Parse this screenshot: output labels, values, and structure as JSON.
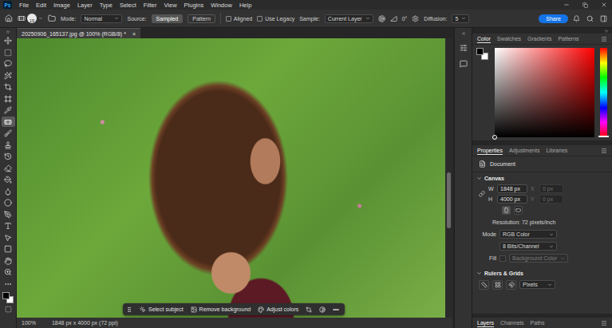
{
  "app": {
    "logo": "Ps"
  },
  "menu": [
    "File",
    "Edit",
    "Image",
    "Layer",
    "Type",
    "Select",
    "Filter",
    "View",
    "Plugins",
    "Window",
    "Help"
  ],
  "options_bar": {
    "brush_size": "19",
    "mode_label": "Mode:",
    "mode": "Normal",
    "source_label": "Source:",
    "source": [
      {
        "label": "Sampled",
        "selected": true
      },
      {
        "label": "Pattern",
        "selected": false
      }
    ],
    "checkboxes": [
      {
        "label": "Aligned",
        "checked": false
      },
      {
        "label": "Use Legacy",
        "checked": false
      }
    ],
    "sample_label": "Sample:",
    "sample": "Current Layer",
    "angle": "0°",
    "diffusion_label": "Diffusion:",
    "diffusion": "5",
    "share": "Share"
  },
  "tools": [
    {
      "selected": false
    },
    {
      "selected": false
    },
    {
      "selected": false
    },
    {
      "selected": false
    },
    {
      "selected": false
    },
    {
      "selected": false
    },
    {
      "selected": false
    },
    {
      "selected": true
    },
    {
      "selected": false
    },
    {
      "selected": false
    },
    {
      "selected": false
    },
    {
      "selected": false
    },
    {
      "selected": false
    },
    {
      "selected": false
    },
    {
      "selected": false
    },
    {
      "selected": false
    },
    {
      "selected": false
    },
    {
      "selected": false
    },
    {
      "selected": false
    },
    {
      "selected": false
    },
    {
      "selected": false
    },
    {
      "selected": false
    }
  ],
  "document_tab": {
    "title": "20250906_165137.jpg @ 100% (RGB/8) *",
    "close": "×"
  },
  "task_bar": {
    "buttons": [
      "Select subject",
      "Remove background",
      "Adjust colors"
    ],
    "more": "•••"
  },
  "status_bar": {
    "zoom": "100%",
    "info": "1848 px x 4000 px (72 ppi)"
  },
  "color_panel": {
    "tabs": [
      {
        "label": "Color",
        "selected": true
      },
      {
        "label": "Swatches",
        "selected": false
      },
      {
        "label": "Gradients",
        "selected": false
      },
      {
        "label": "Patterns",
        "selected": false
      }
    ]
  },
  "properties": {
    "tabs": [
      {
        "label": "Properties",
        "selected": true
      },
      {
        "label": "Adjustments",
        "selected": false
      },
      {
        "label": "Libraries",
        "selected": false
      }
    ],
    "target": "Document",
    "canvas": {
      "title": "Canvas",
      "fields": [
        {
          "label": "W",
          "value": "1848 px",
          "offset_label": "X",
          "offset_value": "0 px",
          "offset_disabled": true
        },
        {
          "label": "H",
          "value": "4000 px",
          "offset_label": "Y",
          "offset_value": "0 px",
          "offset_disabled": true
        }
      ],
      "orientation": [
        {
          "selected": true
        },
        {
          "selected": false
        }
      ],
      "resolution": "Resolution: 72 pixels/inch",
      "mode_label": "Mode",
      "mode": "RGB Color",
      "bits": "8 Bits/Channel",
      "fill_label": "Fill",
      "fill": "Background Color",
      "fill_disabled": true
    },
    "rulers": {
      "title": "Rulers & Grids",
      "units": "Pixels"
    }
  },
  "bottom_tabs": [
    {
      "label": "Layers",
      "selected": true
    },
    {
      "label": "Channels",
      "selected": false
    },
    {
      "label": "Paths",
      "selected": false
    }
  ]
}
